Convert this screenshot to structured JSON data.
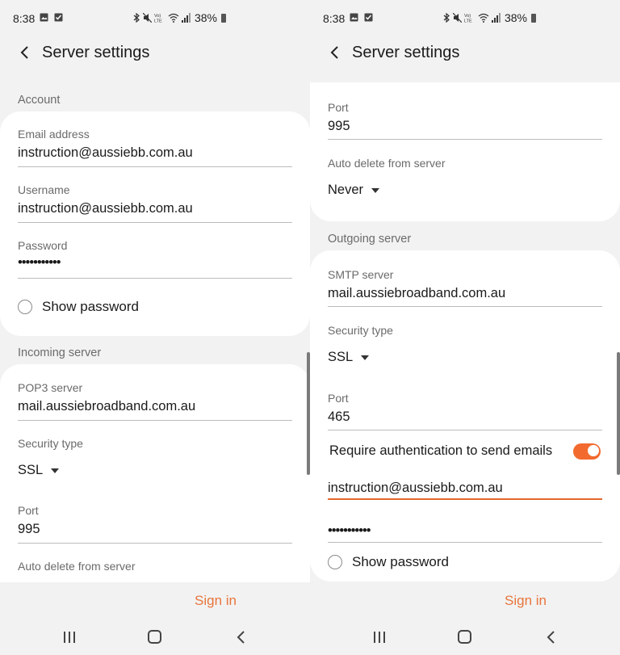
{
  "status": {
    "time": "8:38",
    "battery": "38%"
  },
  "header": {
    "title": "Server settings"
  },
  "left": {
    "account_heading": "Account",
    "email_label": "Email address",
    "email_value": "instruction@aussiebb.com.au",
    "username_label": "Username",
    "username_value": "instruction@aussiebb.com.au",
    "password_label": "Password",
    "password_value": "•••••••••••",
    "show_password": "Show password",
    "incoming_heading": "Incoming server",
    "pop3_label": "POP3 server",
    "pop3_value": "mail.aussiebroadband.com.au",
    "security_label": "Security type",
    "security_value": "SSL",
    "port_label": "Port",
    "port_value": "995",
    "autodelete_label": "Auto delete from server"
  },
  "right": {
    "port_label": "Port",
    "port_value": "995",
    "autodelete_label": "Auto delete from server",
    "autodelete_value": "Never",
    "outgoing_heading": "Outgoing server",
    "smtp_label": "SMTP server",
    "smtp_value": "mail.aussiebroadband.com.au",
    "security_label": "Security type",
    "security_value": "SSL",
    "out_port_label": "Port",
    "out_port_value": "465",
    "require_auth": "Require authentication to send emails",
    "require_auth_on": true,
    "auth_user_value": "instruction@aussiebb.com.au",
    "auth_password_value": "•••••••••••",
    "show_password": "Show password"
  },
  "footer": {
    "sign_in": "Sign in"
  },
  "colors": {
    "accent": "#e8753c",
    "toggle": "#f26a2e"
  },
  "icons": [
    "image-icon",
    "check-square-icon",
    "bluetooth-icon",
    "mute-icon",
    "volte-icon",
    "wifi-icon",
    "signal-icon",
    "battery-icon",
    "back-arrow-icon",
    "recents-icon",
    "home-icon",
    "nav-back-icon"
  ]
}
